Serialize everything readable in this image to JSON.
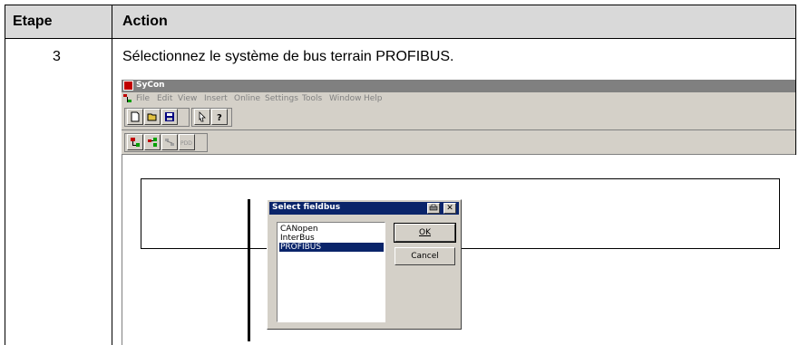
{
  "table": {
    "header_etape": "Etape",
    "header_action": "Action",
    "step_number": "3",
    "step_text": "Sélectionnez le système de bus terrain PROFIBUS."
  },
  "app": {
    "title": "SyCon",
    "menu": [
      "File",
      "Edit",
      "View",
      "Insert",
      "Online",
      "Settings",
      "Tools",
      "Window",
      "Help"
    ],
    "toolbar2_pdd_label": "PDD"
  },
  "dialog": {
    "title": "Select fieldbus",
    "options": [
      "CANopen",
      "InterBus",
      "PROFIBUS"
    ],
    "selected_option": "PROFIBUS",
    "ok_label": "OK",
    "cancel_label": "Cancel",
    "selection_color": "#0a246a"
  }
}
